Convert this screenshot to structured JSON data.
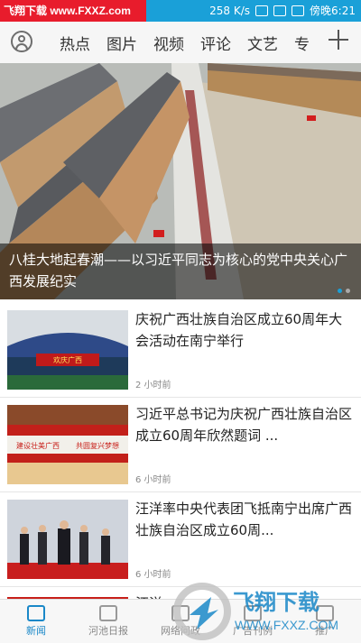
{
  "statusbar": {
    "watermark": "飞翔下载 www.FXXZ.com",
    "speed": "258 K/s",
    "time": "傍晚6:21"
  },
  "tabs": [
    "热点",
    "图片",
    "视频",
    "评论",
    "文艺",
    "专"
  ],
  "hero": {
    "caption": "八桂大地起春潮——以习近平同志为核心的党中央关心广西发展纪实"
  },
  "news": [
    {
      "title": "庆祝广西壮族自治区成立60周年大会活动在南宁举行",
      "time": "2 小时前",
      "banner": "欢庆广西"
    },
    {
      "title": "习近平总书记为庆祝广西壮族自治区成立60周年欣然题词 ...",
      "time": "6 小时前",
      "banner_left": "建设壮美广西",
      "banner_right": "共圆复兴梦想"
    },
    {
      "title": "汪洋率中央代表团飞抵南宁出席广西壮族自治区成立60周...",
      "time": "6 小时前"
    },
    {
      "title": "汪洋"
    }
  ],
  "bottom_nav": [
    "新闻",
    "河池日报",
    "网络问政",
    "广告刊例",
    "推广"
  ],
  "bottom_watermark": {
    "brand": "飞翔下载",
    "url": "WWW.FXXZ.COM"
  },
  "colors": {
    "accent": "#1aa0d8",
    "watermark_red": "#e81c2c",
    "nav_active": "#1a88c8"
  }
}
